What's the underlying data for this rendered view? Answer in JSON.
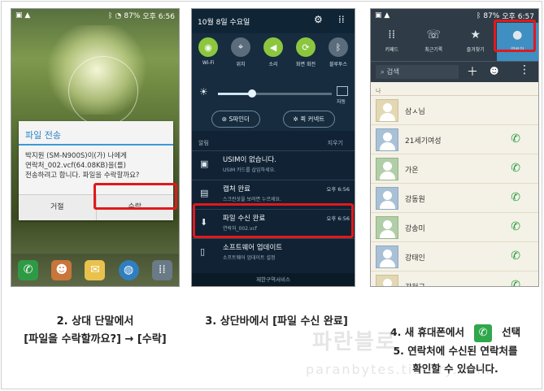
{
  "watermark": {
    "line1": "파란블로",
    "line2": "paranbytes.tistory.com"
  },
  "phone1": {
    "status_time": "오후 6:56",
    "status_battery": "87%",
    "dialog": {
      "title": "파일 전송",
      "body_line1": "박지원 (SM-N900S)이(가) 나에게",
      "body_line2": "연락처_002.vcf(64.08KB)을(를)",
      "body_line3": "전송하려고 합니다. 파일을 수락할까요?",
      "decline": "거절",
      "accept": "수락"
    }
  },
  "caption1": {
    "line1": "2. 상대 단말에서",
    "line2": "[파일을 수락할까요?] → [수락]"
  },
  "phone2": {
    "date": "10월 8일 수요일",
    "quick": [
      {
        "label": "Wi-Fi",
        "icon": "wifi-icon",
        "glyph": "◉",
        "color": "#8cc63f"
      },
      {
        "label": "위치",
        "icon": "location-icon",
        "glyph": "⌖",
        "color": "#5b6d7c"
      },
      {
        "label": "소리",
        "icon": "sound-icon",
        "glyph": "◀",
        "color": "#8cc63f"
      },
      {
        "label": "화면 회전",
        "icon": "rotate-icon",
        "glyph": "⟳",
        "color": "#8cc63f"
      },
      {
        "label": "블루투스",
        "icon": "bluetooth-icon",
        "glyph": "ᛒ",
        "color": "#5b6d7c"
      }
    ],
    "brightness_level": 0.3,
    "auto_label": "자동",
    "s_finder": "S파인더",
    "quick_connect": "퀵 커넥트",
    "notif_header": "알림",
    "clear_all": "지우기",
    "notifications": [
      {
        "title": "USIM이 없습니다.",
        "sub": "USIM 카드를 삽입하세요.",
        "time": "",
        "icon": "sim-icon",
        "glyph": "▣"
      },
      {
        "title": "캡처 완료",
        "sub": "스크린샷을 보려면 누르세요.",
        "time": "오후 6:56",
        "icon": "screenshot-icon",
        "glyph": "▤"
      },
      {
        "title": "파일 수신 완료",
        "sub": "연락처_002.vcf",
        "time": "오후 6:56",
        "icon": "download-icon",
        "glyph": "⬇"
      },
      {
        "title": "소프트웨어 업데이트",
        "sub": "소프트웨어 업데이트 설정",
        "time": "",
        "icon": "update-icon",
        "glyph": "▯"
      }
    ],
    "footer": "제한구역서비스"
  },
  "caption2": {
    "line1": "3. 상단바에서 [파일 수신 완료]"
  },
  "phone3": {
    "status_time": "오후 6:57",
    "status_battery": "87%",
    "tabs": [
      {
        "label": "키패드",
        "icon": "keypad-icon",
        "glyph": "⁞⁞"
      },
      {
        "label": "최근기록",
        "icon": "recent-icon",
        "glyph": "☏"
      },
      {
        "label": "즐겨찾기",
        "icon": "star-icon",
        "glyph": "★"
      },
      {
        "label": "연락처",
        "icon": "contacts-icon",
        "glyph": "●"
      }
    ],
    "search_placeholder": "검색",
    "section_label": "나",
    "contacts": [
      {
        "name": "삼ㅅ님",
        "color": "beige",
        "call": false
      },
      {
        "name": "21세기여성",
        "color": "blue",
        "call": true
      },
      {
        "name": "가온",
        "color": "green",
        "call": true
      },
      {
        "name": "강동원",
        "color": "blue",
        "call": true
      },
      {
        "name": "강송미",
        "color": "green",
        "call": true
      },
      {
        "name": "강태인",
        "color": "blue",
        "call": true
      },
      {
        "name": "강혀군",
        "color": "beige",
        "call": true
      }
    ]
  },
  "caption3": {
    "line1a": "4. 새 휴대폰에서",
    "line1b": "선택",
    "line2": "5. 연락처에 수신된 연락처를",
    "line3": "확인할 수 있습니다."
  }
}
